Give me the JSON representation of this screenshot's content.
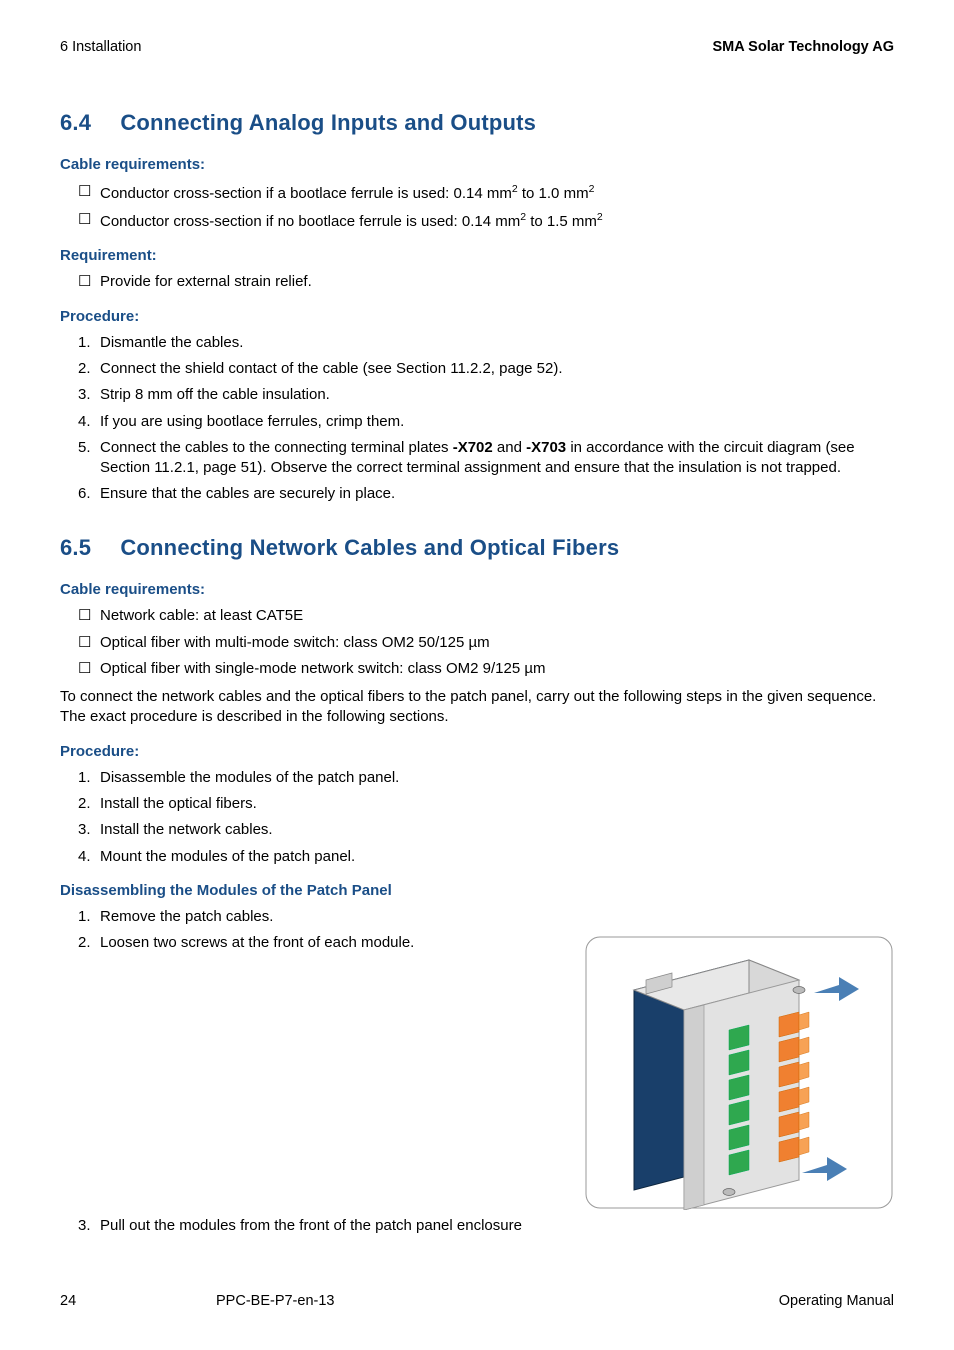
{
  "header": {
    "left": "6  Installation",
    "right": "SMA Solar Technology AG"
  },
  "sections": {
    "s64": {
      "num": "6.4",
      "title": "Connecting Analog Inputs and Outputs",
      "cable_req_head": "Cable requirements:",
      "cable_req_1_a": "Conductor cross-section if a bootlace ferrule is used: 0.14 mm",
      "cable_req_1_b": " to 1.0 mm",
      "cable_req_2_a": "Conductor cross-section if no bootlace ferrule is used: 0.14 mm",
      "cable_req_2_b": " to 1.5 mm",
      "req_head": "Requirement:",
      "req_1": "Provide for external strain relief.",
      "proc_head": "Procedure:",
      "proc_1": "Dismantle the cables.",
      "proc_2": "Connect the shield contact of the cable (see Section 11.2.2, page 52).",
      "proc_3": "Strip 8 mm off the cable insulation.",
      "proc_4": "If you are using bootlace ferrules, crimp them.",
      "proc_5_a": "Connect the cables to the connecting terminal plates ",
      "proc_5_b": "-X702",
      "proc_5_c": " and ",
      "proc_5_d": "-X703",
      "proc_5_e": " in accordance with the circuit diagram (see Section 11.2.1, page 51). Observe the correct terminal assignment and ensure that the insulation is not trapped.",
      "proc_6": "Ensure that the cables are securely in place."
    },
    "s65": {
      "num": "6.5",
      "title": "Connecting Network Cables and Optical Fibers",
      "cable_req_head": "Cable requirements:",
      "cable_req_1": "Network cable: at least CAT5E",
      "cable_req_2": "Optical fiber with multi-mode switch: class OM2 50/125 µm",
      "cable_req_3": "Optical fiber with single-mode network switch: class OM2 9/125 µm",
      "intro": "To connect the network cables and the optical fibers to the patch panel, carry out the following steps in the given sequence. The exact procedure is described in the following sections.",
      "proc_head": "Procedure:",
      "proc_1": "Disassemble the modules of the patch panel.",
      "proc_2": "Install the optical fibers.",
      "proc_3": "Install the network cables.",
      "proc_4": "Mount the modules of the patch panel.",
      "disasm_head": "Disassembling the Modules of the Patch Panel",
      "disasm_1": "Remove the patch cables.",
      "disasm_2": "Loosen two screws at the front of each module.",
      "disasm_3": "Pull out the modules from the front of the patch panel enclosure"
    }
  },
  "footer": {
    "page": "24",
    "doc": "PPC-BE-P7-en-13",
    "type": "Operating Manual"
  }
}
